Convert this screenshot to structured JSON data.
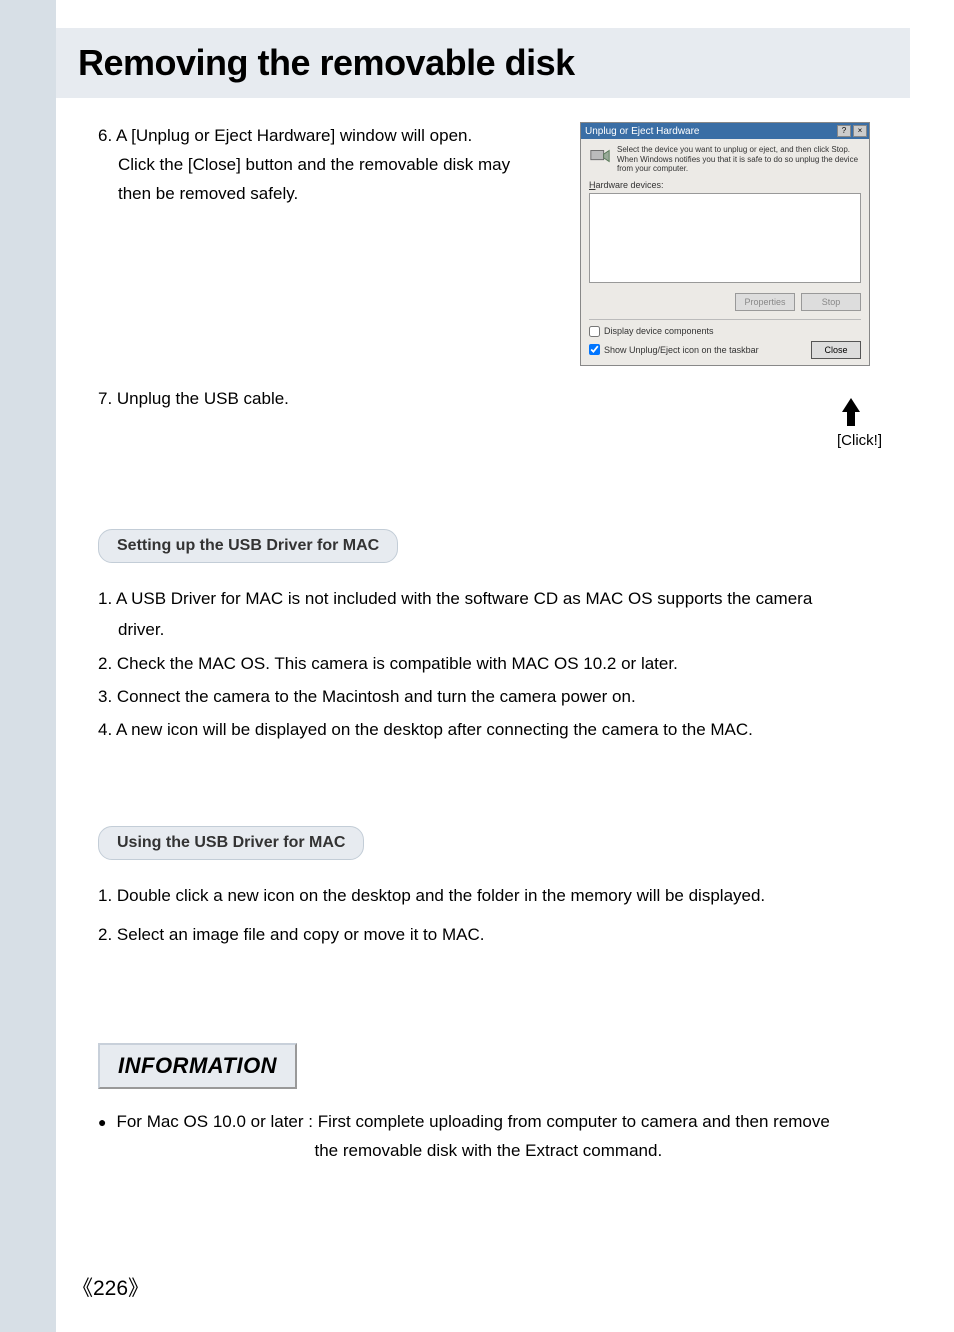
{
  "page": {
    "title": "Removing the removable disk",
    "number": "《226》"
  },
  "steps": {
    "s6_prefix": "6. ",
    "s6_line1": "A [Unplug or Eject Hardware] window will open.",
    "s6_line2": "Click the [Close] button and the removable disk may",
    "s6_line3": "then be removed safely.",
    "s7_prefix": "7. ",
    "s7_line1": "Unplug the USB cable."
  },
  "dialog": {
    "title": "Unplug or Eject Hardware",
    "help_btn": "?",
    "close_btn": "×",
    "desc": "Select the device you want to unplug or eject, and then click Stop. When Windows notifies you that it is safe to do so unplug the device from your computer.",
    "hw_label": "Hardware devices:",
    "properties_btn": "Properties",
    "stop_btn": "Stop",
    "chk1_label": "Display device components",
    "chk1_checked": false,
    "chk2_label": "Show Unplug/Eject icon on the taskbar",
    "chk2_checked": true,
    "close_label": "Close",
    "annotation": "[Click!]"
  },
  "section_mac_setup": {
    "header": "Setting up the USB Driver for MAC",
    "i1": "1. A USB Driver for MAC is not included with the software CD as MAC OS supports the camera",
    "i1b": "driver.",
    "i2": "2. Check the MAC OS. This camera is compatible with MAC OS 10.2 or later.",
    "i3": "3. Connect the camera to the Macintosh and turn the camera power on.",
    "i4": "4. A new icon will be displayed on the desktop after connecting the camera to the MAC."
  },
  "section_mac_using": {
    "header": "Using the USB Driver for MAC",
    "i1": "1. Double click a new icon on the desktop and the folder in the memory will be displayed.",
    "i2": "2. Select an image file and copy or move it to MAC."
  },
  "info": {
    "header": "INFORMATION",
    "bullet": "●",
    "line1": "For Mac OS 10.0 or later : First complete uploading from computer to camera and then remove",
    "line2": "the removable disk with the Extract command."
  }
}
